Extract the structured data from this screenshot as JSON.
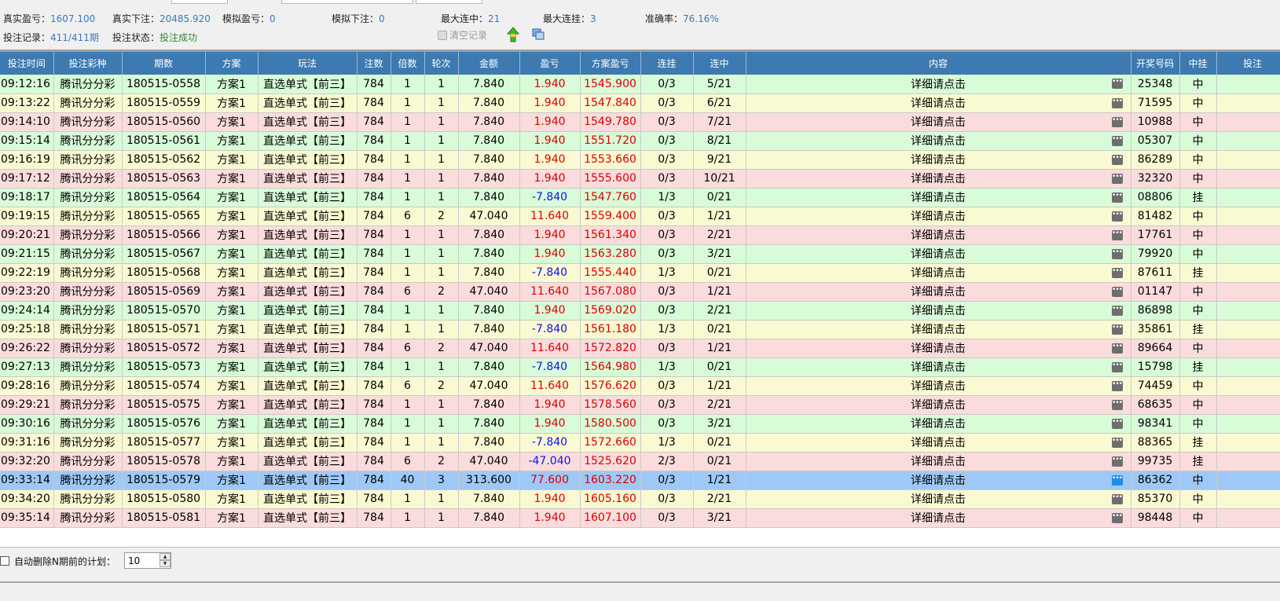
{
  "stats": {
    "real_profit_label": "真实盈亏：",
    "real_profit": "1607.100",
    "real_bet_label": "真实下注：",
    "real_bet": "20485.920",
    "sim_profit_label": "模拟盈亏：",
    "sim_profit": "0",
    "sim_bet_label": "模拟下注：",
    "sim_bet": "0",
    "max_win_streak_label": "最大连中：",
    "max_win_streak": "21",
    "max_lose_streak_label": "最大连挂：",
    "max_lose_streak": "3",
    "accuracy_label": "准确率：",
    "accuracy": "76.16%",
    "record_label": "投注记录：",
    "record": "411/411期",
    "state_label": "投注状态：",
    "state": "投注成功"
  },
  "toolbar": {
    "clear_label": "清空记录",
    "up_icon": "green-up-arrow-icon",
    "copy_icon": "copy-window-icon"
  },
  "table": {
    "headers": [
      "投注时间",
      "投注彩种",
      "期数",
      "方案",
      "玩法",
      "注数",
      "倍数",
      "轮次",
      "金额",
      "盈亏",
      "方案盈亏",
      "连挂",
      "连中",
      "内容",
      "开奖号码",
      "中挂",
      "投注"
    ],
    "rows": [
      {
        "color": "green",
        "time": "09:12:16",
        "lottery": "腾讯分分彩",
        "issue": "180515-0558",
        "plan": "方案1",
        "play": "直选单式【前三】",
        "count": "784",
        "multiple": "1",
        "round": "1",
        "amount": "7.840",
        "profit": "1.940",
        "plan_profit": "1545.900",
        "lose_streak": "0/3",
        "win_streak": "5/21",
        "content": "详细请点击",
        "draw": "25348",
        "result": "中"
      },
      {
        "color": "yellow",
        "time": "09:13:22",
        "lottery": "腾讯分分彩",
        "issue": "180515-0559",
        "plan": "方案1",
        "play": "直选单式【前三】",
        "count": "784",
        "multiple": "1",
        "round": "1",
        "amount": "7.840",
        "profit": "1.940",
        "plan_profit": "1547.840",
        "lose_streak": "0/3",
        "win_streak": "6/21",
        "content": "详细请点击",
        "draw": "71595",
        "result": "中"
      },
      {
        "color": "pink",
        "time": "09:14:10",
        "lottery": "腾讯分分彩",
        "issue": "180515-0560",
        "plan": "方案1",
        "play": "直选单式【前三】",
        "count": "784",
        "multiple": "1",
        "round": "1",
        "amount": "7.840",
        "profit": "1.940",
        "plan_profit": "1549.780",
        "lose_streak": "0/3",
        "win_streak": "7/21",
        "content": "详细请点击",
        "draw": "10988",
        "result": "中"
      },
      {
        "color": "green",
        "time": "09:15:14",
        "lottery": "腾讯分分彩",
        "issue": "180515-0561",
        "plan": "方案1",
        "play": "直选单式【前三】",
        "count": "784",
        "multiple": "1",
        "round": "1",
        "amount": "7.840",
        "profit": "1.940",
        "plan_profit": "1551.720",
        "lose_streak": "0/3",
        "win_streak": "8/21",
        "content": "详细请点击",
        "draw": "05307",
        "result": "中"
      },
      {
        "color": "yellow",
        "time": "09:16:19",
        "lottery": "腾讯分分彩",
        "issue": "180515-0562",
        "plan": "方案1",
        "play": "直选单式【前三】",
        "count": "784",
        "multiple": "1",
        "round": "1",
        "amount": "7.840",
        "profit": "1.940",
        "plan_profit": "1553.660",
        "lose_streak": "0/3",
        "win_streak": "9/21",
        "content": "详细请点击",
        "draw": "86289",
        "result": "中"
      },
      {
        "color": "pink",
        "time": "09:17:12",
        "lottery": "腾讯分分彩",
        "issue": "180515-0563",
        "plan": "方案1",
        "play": "直选单式【前三】",
        "count": "784",
        "multiple": "1",
        "round": "1",
        "amount": "7.840",
        "profit": "1.940",
        "plan_profit": "1555.600",
        "lose_streak": "0/3",
        "win_streak": "10/21",
        "content": "详细请点击",
        "draw": "32320",
        "result": "中"
      },
      {
        "color": "green",
        "time": "09:18:17",
        "lottery": "腾讯分分彩",
        "issue": "180515-0564",
        "plan": "方案1",
        "play": "直选单式【前三】",
        "count": "784",
        "multiple": "1",
        "round": "1",
        "amount": "7.840",
        "profit": "-7.840",
        "plan_profit": "1547.760",
        "lose_streak": "1/3",
        "win_streak": "0/21",
        "content": "详细请点击",
        "draw": "08806",
        "result": "挂"
      },
      {
        "color": "yellow",
        "time": "09:19:15",
        "lottery": "腾讯分分彩",
        "issue": "180515-0565",
        "plan": "方案1",
        "play": "直选单式【前三】",
        "count": "784",
        "multiple": "6",
        "round": "2",
        "amount": "47.040",
        "profit": "11.640",
        "plan_profit": "1559.400",
        "lose_streak": "0/3",
        "win_streak": "1/21",
        "content": "详细请点击",
        "draw": "81482",
        "result": "中"
      },
      {
        "color": "pink",
        "time": "09:20:21",
        "lottery": "腾讯分分彩",
        "issue": "180515-0566",
        "plan": "方案1",
        "play": "直选单式【前三】",
        "count": "784",
        "multiple": "1",
        "round": "1",
        "amount": "7.840",
        "profit": "1.940",
        "plan_profit": "1561.340",
        "lose_streak": "0/3",
        "win_streak": "2/21",
        "content": "详细请点击",
        "draw": "17761",
        "result": "中"
      },
      {
        "color": "green",
        "time": "09:21:15",
        "lottery": "腾讯分分彩",
        "issue": "180515-0567",
        "plan": "方案1",
        "play": "直选单式【前三】",
        "count": "784",
        "multiple": "1",
        "round": "1",
        "amount": "7.840",
        "profit": "1.940",
        "plan_profit": "1563.280",
        "lose_streak": "0/3",
        "win_streak": "3/21",
        "content": "详细请点击",
        "draw": "79920",
        "result": "中"
      },
      {
        "color": "yellow",
        "time": "09:22:19",
        "lottery": "腾讯分分彩",
        "issue": "180515-0568",
        "plan": "方案1",
        "play": "直选单式【前三】",
        "count": "784",
        "multiple": "1",
        "round": "1",
        "amount": "7.840",
        "profit": "-7.840",
        "plan_profit": "1555.440",
        "lose_streak": "1/3",
        "win_streak": "0/21",
        "content": "详细请点击",
        "draw": "87611",
        "result": "挂"
      },
      {
        "color": "pink",
        "time": "09:23:20",
        "lottery": "腾讯分分彩",
        "issue": "180515-0569",
        "plan": "方案1",
        "play": "直选单式【前三】",
        "count": "784",
        "multiple": "6",
        "round": "2",
        "amount": "47.040",
        "profit": "11.640",
        "plan_profit": "1567.080",
        "lose_streak": "0/3",
        "win_streak": "1/21",
        "content": "详细请点击",
        "draw": "01147",
        "result": "中"
      },
      {
        "color": "green",
        "time": "09:24:14",
        "lottery": "腾讯分分彩",
        "issue": "180515-0570",
        "plan": "方案1",
        "play": "直选单式【前三】",
        "count": "784",
        "multiple": "1",
        "round": "1",
        "amount": "7.840",
        "profit": "1.940",
        "plan_profit": "1569.020",
        "lose_streak": "0/3",
        "win_streak": "2/21",
        "content": "详细请点击",
        "draw": "86898",
        "result": "中"
      },
      {
        "color": "yellow",
        "time": "09:25:18",
        "lottery": "腾讯分分彩",
        "issue": "180515-0571",
        "plan": "方案1",
        "play": "直选单式【前三】",
        "count": "784",
        "multiple": "1",
        "round": "1",
        "amount": "7.840",
        "profit": "-7.840",
        "plan_profit": "1561.180",
        "lose_streak": "1/3",
        "win_streak": "0/21",
        "content": "详细请点击",
        "draw": "35861",
        "result": "挂"
      },
      {
        "color": "pink",
        "time": "09:26:22",
        "lottery": "腾讯分分彩",
        "issue": "180515-0572",
        "plan": "方案1",
        "play": "直选单式【前三】",
        "count": "784",
        "multiple": "6",
        "round": "2",
        "amount": "47.040",
        "profit": "11.640",
        "plan_profit": "1572.820",
        "lose_streak": "0/3",
        "win_streak": "1/21",
        "content": "详细请点击",
        "draw": "89664",
        "result": "中"
      },
      {
        "color": "green",
        "time": "09:27:13",
        "lottery": "腾讯分分彩",
        "issue": "180515-0573",
        "plan": "方案1",
        "play": "直选单式【前三】",
        "count": "784",
        "multiple": "1",
        "round": "1",
        "amount": "7.840",
        "profit": "-7.840",
        "plan_profit": "1564.980",
        "lose_streak": "1/3",
        "win_streak": "0/21",
        "content": "详细请点击",
        "draw": "15798",
        "result": "挂"
      },
      {
        "color": "yellow",
        "time": "09:28:16",
        "lottery": "腾讯分分彩",
        "issue": "180515-0574",
        "plan": "方案1",
        "play": "直选单式【前三】",
        "count": "784",
        "multiple": "6",
        "round": "2",
        "amount": "47.040",
        "profit": "11.640",
        "plan_profit": "1576.620",
        "lose_streak": "0/3",
        "win_streak": "1/21",
        "content": "详细请点击",
        "draw": "74459",
        "result": "中"
      },
      {
        "color": "pink",
        "time": "09:29:21",
        "lottery": "腾讯分分彩",
        "issue": "180515-0575",
        "plan": "方案1",
        "play": "直选单式【前三】",
        "count": "784",
        "multiple": "1",
        "round": "1",
        "amount": "7.840",
        "profit": "1.940",
        "plan_profit": "1578.560",
        "lose_streak": "0/3",
        "win_streak": "2/21",
        "content": "详细请点击",
        "draw": "68635",
        "result": "中"
      },
      {
        "color": "green",
        "time": "09:30:16",
        "lottery": "腾讯分分彩",
        "issue": "180515-0576",
        "plan": "方案1",
        "play": "直选单式【前三】",
        "count": "784",
        "multiple": "1",
        "round": "1",
        "amount": "7.840",
        "profit": "1.940",
        "plan_profit": "1580.500",
        "lose_streak": "0/3",
        "win_streak": "3/21",
        "content": "详细请点击",
        "draw": "98341",
        "result": "中"
      },
      {
        "color": "yellow",
        "time": "09:31:16",
        "lottery": "腾讯分分彩",
        "issue": "180515-0577",
        "plan": "方案1",
        "play": "直选单式【前三】",
        "count": "784",
        "multiple": "1",
        "round": "1",
        "amount": "7.840",
        "profit": "-7.840",
        "plan_profit": "1572.660",
        "lose_streak": "1/3",
        "win_streak": "0/21",
        "content": "详细请点击",
        "draw": "88365",
        "result": "挂"
      },
      {
        "color": "pink",
        "time": "09:32:20",
        "lottery": "腾讯分分彩",
        "issue": "180515-0578",
        "plan": "方案1",
        "play": "直选单式【前三】",
        "count": "784",
        "multiple": "6",
        "round": "2",
        "amount": "47.040",
        "profit": "-47.040",
        "plan_profit": "1525.620",
        "lose_streak": "2/3",
        "win_streak": "0/21",
        "content": "详细请点击",
        "draw": "99735",
        "result": "挂"
      },
      {
        "color": "sel",
        "time": "09:33:14",
        "lottery": "腾讯分分彩",
        "issue": "180515-0579",
        "plan": "方案1",
        "play": "直选单式【前三】",
        "count": "784",
        "multiple": "40",
        "round": "3",
        "amount": "313.600",
        "profit": "77.600",
        "plan_profit": "1603.220",
        "lose_streak": "0/3",
        "win_streak": "1/21",
        "content": "详细请点击",
        "draw": "86362",
        "result": "中"
      },
      {
        "color": "yellow",
        "time": "09:34:20",
        "lottery": "腾讯分分彩",
        "issue": "180515-0580",
        "plan": "方案1",
        "play": "直选单式【前三】",
        "count": "784",
        "multiple": "1",
        "round": "1",
        "amount": "7.840",
        "profit": "1.940",
        "plan_profit": "1605.160",
        "lose_streak": "0/3",
        "win_streak": "2/21",
        "content": "详细请点击",
        "draw": "85370",
        "result": "中"
      },
      {
        "color": "pink",
        "time": "09:35:14",
        "lottery": "腾讯分分彩",
        "issue": "180515-0581",
        "plan": "方案1",
        "play": "直选单式【前三】",
        "count": "784",
        "multiple": "1",
        "round": "1",
        "amount": "7.840",
        "profit": "1.940",
        "plan_profit": "1607.100",
        "lose_streak": "0/3",
        "win_streak": "3/21",
        "content": "详细请点击",
        "draw": "98448",
        "result": "中"
      }
    ]
  },
  "footer": {
    "auto_delete_label": "自动删除N期前的计划：",
    "auto_delete_value": "10"
  },
  "colors": {
    "header_bg": "#3d7ab2",
    "row_green": "#d8fcd8",
    "row_yellow": "#fafad2",
    "row_pink": "#fbdcdc",
    "row_selected": "#9ec9f7",
    "profit_positive": "#dd0000",
    "profit_negative": "#1010ee",
    "stat_value": "#3a79c2",
    "state_ok": "#2f8a2f"
  }
}
